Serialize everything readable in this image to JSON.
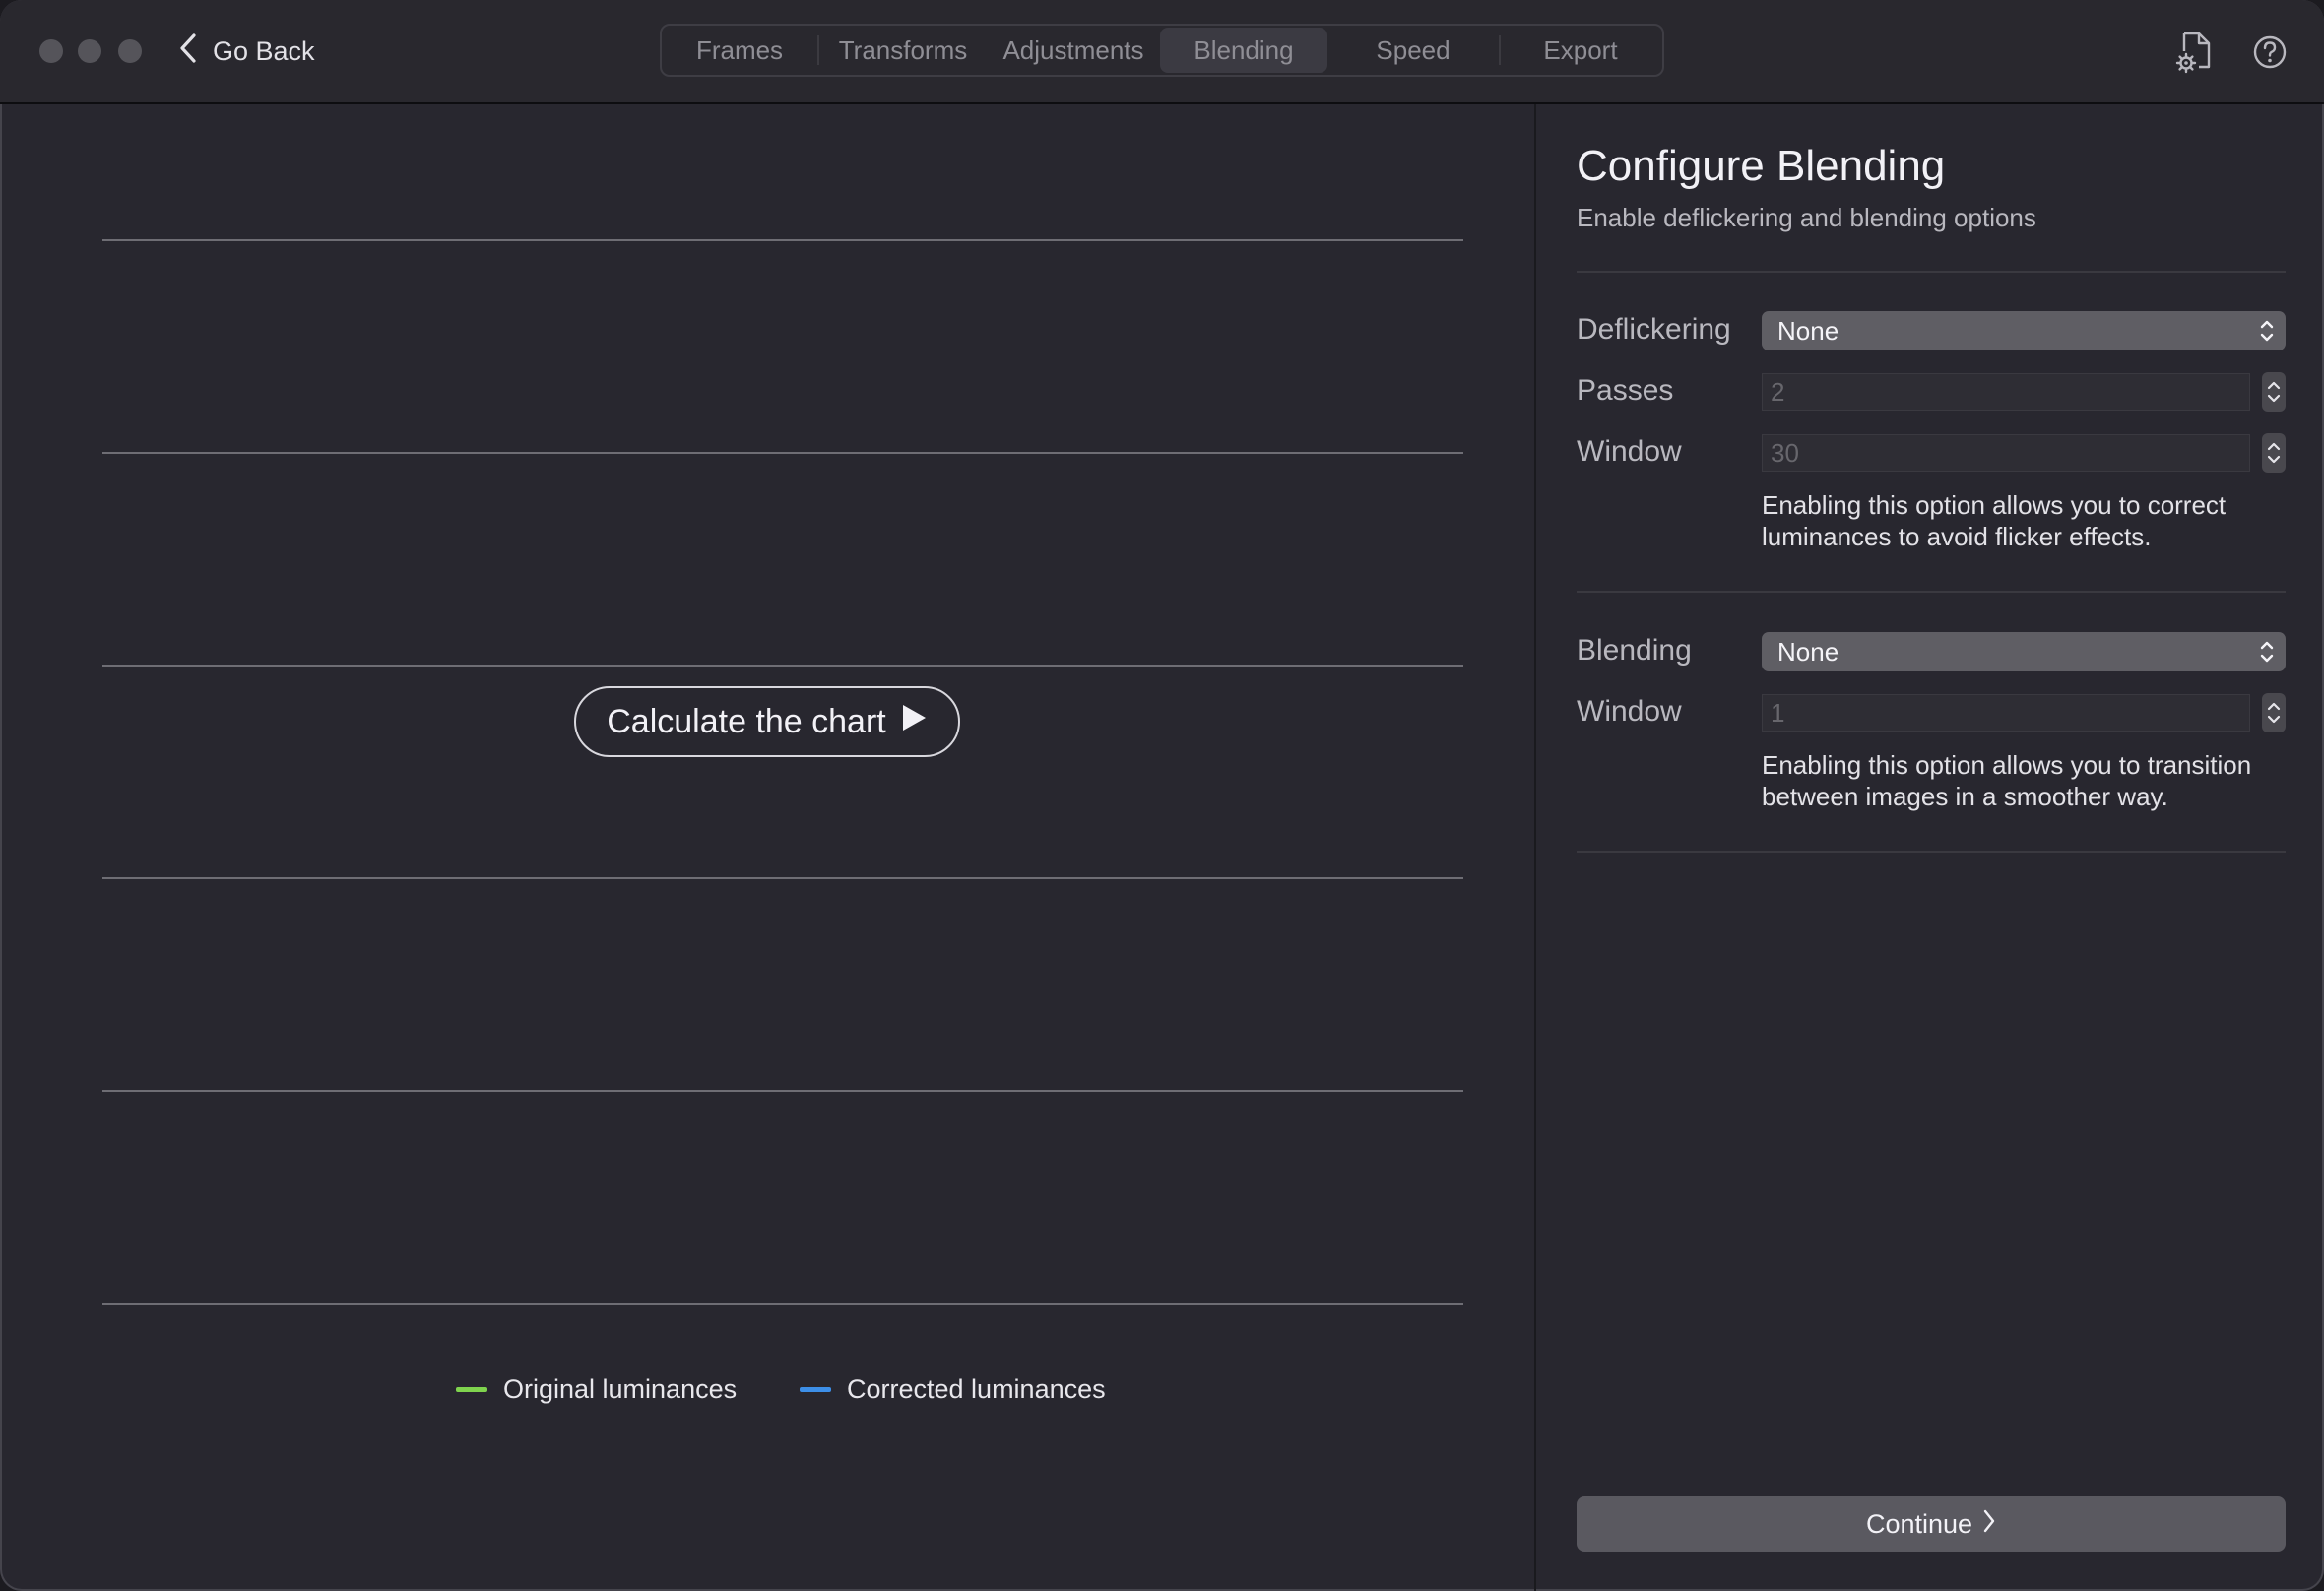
{
  "titlebar": {
    "back_label": "Go Back",
    "tabs": [
      {
        "label": "Frames"
      },
      {
        "label": "Transforms"
      },
      {
        "label": "Adjustments"
      },
      {
        "label": "Blending",
        "active": true
      },
      {
        "label": "Speed"
      },
      {
        "label": "Export"
      }
    ],
    "icons": [
      "document-settings-icon",
      "help-icon"
    ]
  },
  "chart": {
    "calculate_label": "Calculate the chart",
    "legend": [
      {
        "label": "Original luminances",
        "color": "#7fd34e"
      },
      {
        "label": "Corrected luminances",
        "color": "#3d8fe8"
      }
    ]
  },
  "panel": {
    "title": "Configure Blending",
    "subtitle": "Enable deflickering and blending options",
    "deflickering": {
      "label": "Deflickering",
      "value": "None",
      "passes_label": "Passes",
      "passes_value": "2",
      "window_label": "Window",
      "window_value": "30",
      "help": "Enabling this option allows you to correct luminances to avoid flicker effects."
    },
    "blending": {
      "label": "Blending",
      "value": "None",
      "window_label": "Window",
      "window_value": "1",
      "help": "Enabling this option allows you to transition between images in a smoother way."
    },
    "continue_label": "Continue"
  },
  "colors": {
    "window_bg": "#28272f",
    "accent_green": "#7fd34e",
    "accent_blue": "#3d8fe8"
  }
}
